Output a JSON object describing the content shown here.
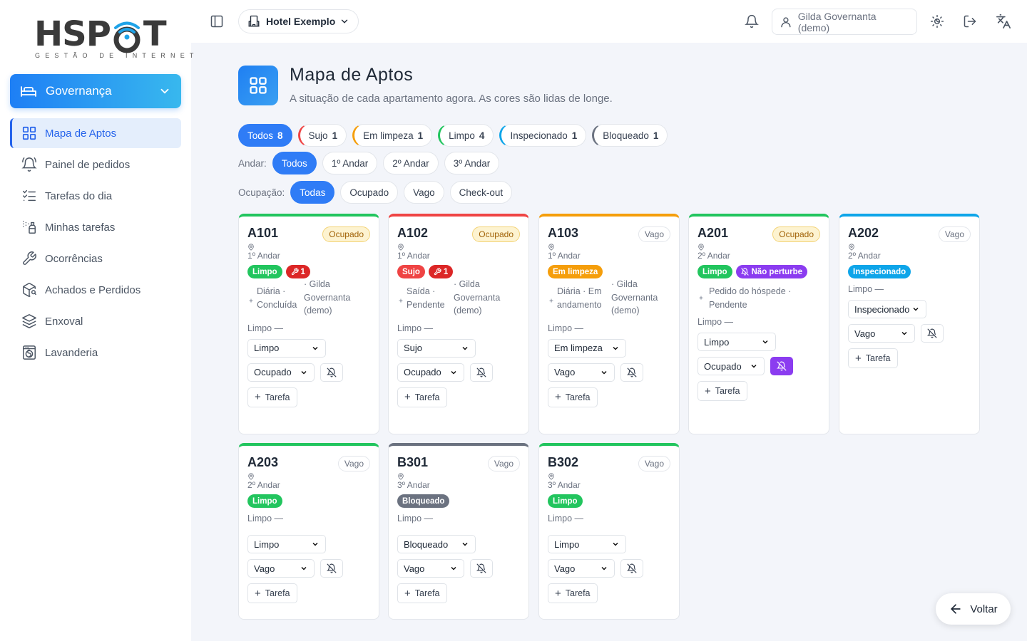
{
  "brand": {
    "name_left": "HSP",
    "name_right": "T",
    "tagline": "GESTÃO DE INTERNET"
  },
  "module": {
    "label": "Governança"
  },
  "nav": [
    {
      "label": "Mapa de Aptos",
      "icon": "grid-icon",
      "active": true
    },
    {
      "label": "Painel de pedidos",
      "icon": "bell-ring-icon"
    },
    {
      "label": "Tarefas do dia",
      "icon": "list-check-icon"
    },
    {
      "label": "Minhas tarefas",
      "icon": "spray-bottle-icon"
    },
    {
      "label": "Ocorrências",
      "icon": "wrench-icon"
    },
    {
      "label": "Achados e Perdidos",
      "icon": "package-search-icon"
    },
    {
      "label": "Enxoval",
      "icon": "layers-icon"
    },
    {
      "label": "Lavanderia",
      "icon": "washing-machine-icon"
    }
  ],
  "topbar": {
    "hotel": "Hotel Exemplo",
    "user": "Gilda Governanta (demo)"
  },
  "page": {
    "title": "Mapa de Aptos",
    "subtitle": "A situação de cada apartamento agora. As cores são lidas de longe."
  },
  "status_filters": [
    {
      "label": "Todos",
      "count": "8"
    },
    {
      "label": "Sujo",
      "count": "1"
    },
    {
      "label": "Em limpeza",
      "count": "1"
    },
    {
      "label": "Limpo",
      "count": "4"
    },
    {
      "label": "Inspecionado",
      "count": "1"
    },
    {
      "label": "Bloqueado",
      "count": "1"
    }
  ],
  "floor_filter": {
    "label": "Andar:",
    "options": [
      "Todos",
      "1º Andar",
      "2º Andar",
      "3º Andar"
    ]
  },
  "occupancy_filter": {
    "label": "Ocupação:",
    "options": [
      "Todas",
      "Ocupado",
      "Vago",
      "Check-out"
    ]
  },
  "colors": {
    "accent": "#2f7cf6",
    "limpo": "#22c55e",
    "sujo": "#ef4444",
    "em_limpeza": "#f59e0b",
    "inspecionado": "#0ea5e9",
    "bloqueado": "#6b7280",
    "nao_perturbe": "#8b3cf0"
  },
  "rooms": [
    {
      "code": "A101",
      "occupancy": "Ocupado",
      "floor": "1º Andar",
      "status": "Limpo",
      "issues": "1",
      "task_l1": "Diária ·",
      "task_l2": "Concluída",
      "task_r1": "· Gilda",
      "task_r2": "Governanta",
      "task_r3": "(demo)",
      "cleaner": "Limpo —",
      "sel_status": "Limpo",
      "sel_occ": "Ocupado",
      "add": "Tarefa"
    },
    {
      "code": "A102",
      "occupancy": "Ocupado",
      "floor": "1º Andar",
      "status": "Sujo",
      "issues": "1",
      "task_l1": "Saída ·",
      "task_l2": "Pendente",
      "task_r1": "· Gilda",
      "task_r2": "Governanta",
      "task_r3": "(demo)",
      "cleaner": "Limpo —",
      "sel_status": "Sujo",
      "sel_occ": "Ocupado",
      "add": "Tarefa"
    },
    {
      "code": "A103",
      "occupancy": "Vago",
      "floor": "1º Andar",
      "status": "Em limpeza",
      "task_l1": "Diária · Em",
      "task_l2": "andamento",
      "task_r1": "· Gilda",
      "task_r2": "Governanta",
      "task_r3": "(demo)",
      "cleaner": "Limpo —",
      "sel_status": "Em limpeza",
      "sel_occ": "Vago",
      "add": "Tarefa"
    },
    {
      "code": "A201",
      "occupancy": "Ocupado",
      "floor": "2º Andar",
      "status": "Limpo",
      "dnd": "Não perturbe",
      "task_l1": "Pedido do hóspede ·",
      "task_l2": "Pendente",
      "cleaner": "Limpo —",
      "sel_status": "Limpo",
      "sel_occ": "Ocupado",
      "add": "Tarefa"
    },
    {
      "code": "A202",
      "occupancy": "Vago",
      "floor": "2º Andar",
      "status": "Inspecionado",
      "cleaner": "Limpo —",
      "sel_status": "Inspecionado",
      "sel_occ": "Vago",
      "add": "Tarefa"
    },
    {
      "code": "A203",
      "occupancy": "Vago",
      "floor": "2º Andar",
      "status": "Limpo",
      "cleaner": "Limpo —",
      "sel_status": "Limpo",
      "sel_occ": "Vago",
      "add": "Tarefa"
    },
    {
      "code": "B301",
      "occupancy": "Vago",
      "floor": "3º Andar",
      "status": "Bloqueado",
      "cleaner": "Limpo —",
      "sel_status": "Bloqueado",
      "sel_occ": "Vago",
      "add": "Tarefa"
    },
    {
      "code": "B302",
      "occupancy": "Vago",
      "floor": "3º Andar",
      "status": "Limpo",
      "cleaner": "Limpo —",
      "sel_status": "Limpo",
      "sel_occ": "Vago",
      "add": "Tarefa"
    }
  ],
  "back_button": "Voltar"
}
